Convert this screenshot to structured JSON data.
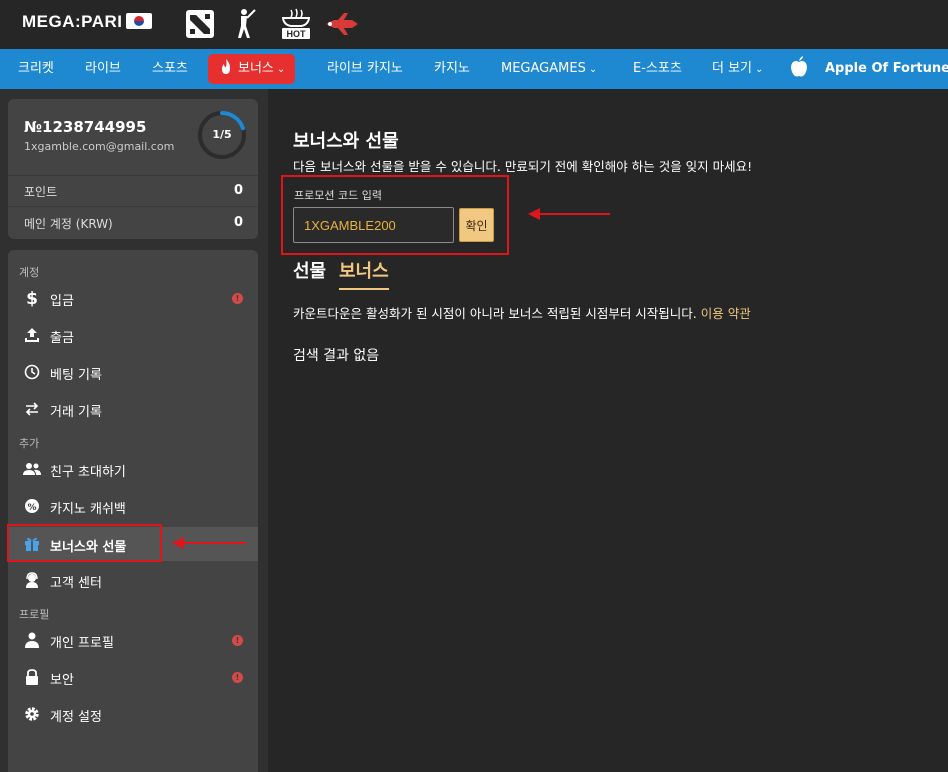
{
  "brand": {
    "logo_text": "MEGA:PARI"
  },
  "topbar": {
    "game_icons": [
      "dota-icon",
      "cricket-player-icon",
      "hot-cup-icon",
      "plane-icon"
    ],
    "hot_label": "HOT"
  },
  "nav": {
    "items": [
      {
        "label": "크리켓"
      },
      {
        "label": "라이브"
      },
      {
        "label": "스포츠"
      },
      {
        "label": "보너스",
        "active": true
      },
      {
        "label": "라이브 카지노"
      },
      {
        "label": "카지노"
      },
      {
        "label": "MEGAGAMES"
      },
      {
        "label": "E-스포츠"
      },
      {
        "label": "더 보기"
      },
      {
        "label": "Apple Of Fortune"
      }
    ]
  },
  "profile": {
    "account_number": "№1238744995",
    "email": "1xgamble.com@gmail.com",
    "progress_text": "1/5",
    "progress_fraction": 0.2,
    "points_label": "포인트",
    "points_value": "0",
    "main_account_label": "메인 계정 (KRW)",
    "main_account_value": "0"
  },
  "sidebar": {
    "sections": {
      "account": "계정",
      "extra": "추가",
      "profile": "프로필"
    },
    "items": [
      {
        "label": "입금",
        "icon": "dollar-icon",
        "alert": true
      },
      {
        "label": "출금",
        "icon": "upload-icon",
        "alert": false
      },
      {
        "label": "베팅 기록",
        "icon": "clock-icon",
        "alert": false
      },
      {
        "label": "거래 기록",
        "icon": "swap-icon",
        "alert": false
      },
      {
        "label": "친구 초대하기",
        "icon": "users-icon",
        "alert": false
      },
      {
        "label": "카지노 캐쉬백",
        "icon": "cashback-icon",
        "alert": false
      },
      {
        "label": "보너스와 선물",
        "icon": "gift-icon",
        "alert": false,
        "active": true
      },
      {
        "label": "고객 센터",
        "icon": "support-icon",
        "alert": false
      },
      {
        "label": "개인 프로필",
        "icon": "person-icon",
        "alert": true
      },
      {
        "label": "보안",
        "icon": "lock-icon",
        "alert": true
      },
      {
        "label": "계정 설정",
        "icon": "gear-icon",
        "alert": false
      }
    ],
    "alert_glyph": "!"
  },
  "main": {
    "title": "보너스와 선물",
    "subtitle": "다음 보너스와 선물을 받을 수 있습니다. 만료되기 전에 확인해야 하는 것을 잊지 마세요!",
    "promo_label": "프로모션 코드 입력",
    "promo_value": "1XGAMBLE200",
    "promo_button": "확인",
    "tabs": [
      {
        "label": "선물",
        "active": false
      },
      {
        "label": "보너스",
        "active": true
      }
    ],
    "notice": "카운트다운은 활성화가 된 시점이 아니라 보너스 적립된 시점부터 시작됩니다.",
    "terms_link": "이용 약관",
    "empty_text": "검색 결과 없음"
  },
  "colors": {
    "nav_blue": "#1e88d1",
    "bonus_red": "#e5302f",
    "gold": "#f1c882",
    "annotation_red": "#e0151b"
  }
}
